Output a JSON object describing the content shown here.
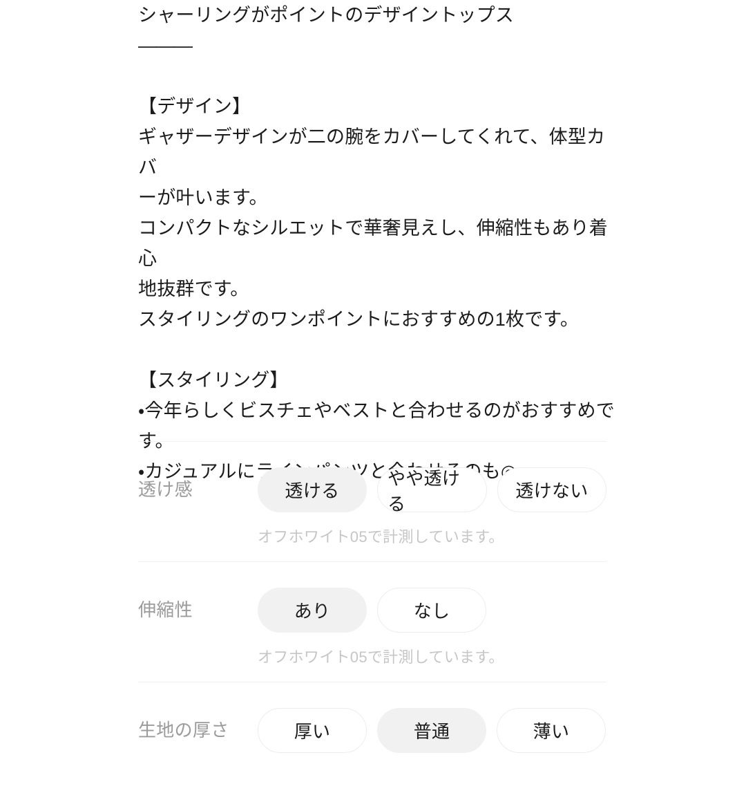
{
  "description": {
    "lines": [
      "シャーリングがポイントのデザイントップス",
      "———",
      "",
      "【デザイン】",
      "ギャザーデザインが二の腕をカバーしてくれて、体型カバ",
      "ーが叶います。",
      "コンパクトなシルエットで華奢見えし、伸縮性もあり着心",
      "地抜群です。",
      "スタイリングのワンポイントにおすすめの1枚です。",
      "",
      "【スタイリング】",
      "・今年らしくビスチェやベストと合わせるのがおすすめで",
      "す。",
      "・カジュアルにラインパンツと合わせるのも◎"
    ]
  },
  "attributes": {
    "rows": [
      {
        "label": "透け感",
        "options": [
          {
            "text": "透ける",
            "selected": true
          },
          {
            "text": "やや透ける",
            "selected": false
          },
          {
            "text": "透けない",
            "selected": false
          }
        ],
        "note": "オフホワイト05で計測しています。"
      },
      {
        "label": "伸縮性",
        "options": [
          {
            "text": "あり",
            "selected": true
          },
          {
            "text": "なし",
            "selected": false
          }
        ],
        "note": "オフホワイト05で計測しています。"
      },
      {
        "label": "生地の厚さ",
        "options": [
          {
            "text": "厚い",
            "selected": false
          },
          {
            "text": "普通",
            "selected": true
          },
          {
            "text": "薄い",
            "selected": false
          }
        ],
        "note": ""
      }
    ]
  },
  "colors": {
    "background": "#ffffff",
    "text": "#1c1c1c",
    "label": "#9b9b9b",
    "note": "#c6c6c6",
    "divider": "#f0f0f0",
    "pill_selected_bg": "#f1f1f1",
    "pill_border": "#ededed"
  }
}
